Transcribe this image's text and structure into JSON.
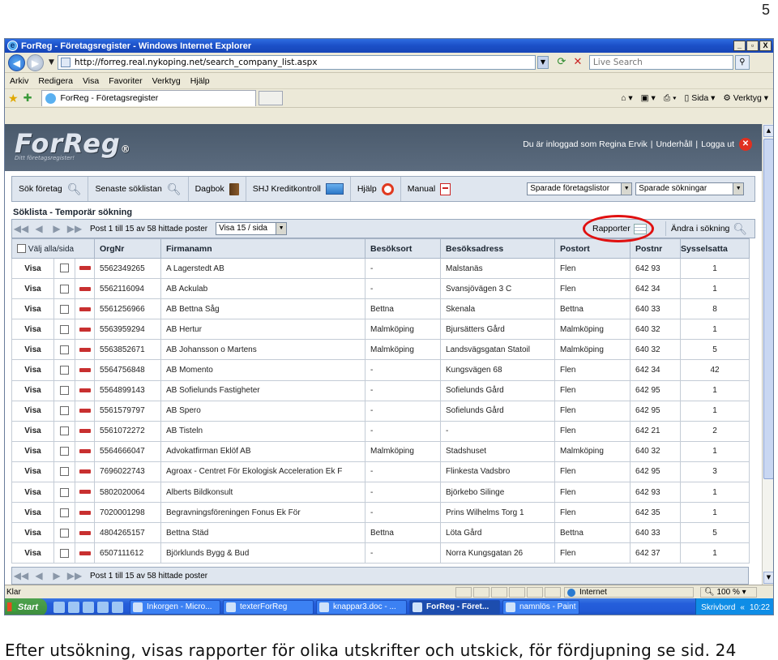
{
  "page_number": "5",
  "caption": "Efter utsökning, visas rapporter för olika utskrifter och utskick, för fördjupning se sid. 24",
  "window": {
    "title": "ForReg - Företagsregister - Windows Internet Explorer",
    "minimize": "_",
    "maximize": "▫",
    "close": "X"
  },
  "address_bar": {
    "url": "http://forreg.real.nykoping.net/search_company_list.aspx",
    "search_placeholder": "Live Search"
  },
  "menu": [
    "Arkiv",
    "Redigera",
    "Visa",
    "Favoriter",
    "Verktyg",
    "Hjälp"
  ],
  "tab": {
    "title": "ForReg - Företagsregister"
  },
  "command_bar": {
    "page": "Sida",
    "tools": "Verktyg"
  },
  "app": {
    "logo": "ForReg",
    "slogan": "Ditt företagsregister!",
    "user_text": "Du är inloggad som Regina Ervik",
    "maintenance": "Underhåll",
    "logout": "Logga ut",
    "toolbar": {
      "sok_foretag": "Sök företag",
      "senaste": "Senaste söklistan",
      "dagbok": "Dagbok",
      "shj": "SHJ Kreditkontroll",
      "hjalp": "Hjälp",
      "manual": "Manual",
      "sparade_listor": "Sparade företagslistor",
      "sparade_sokningar": "Sparade sökningar"
    },
    "list_title": "Söklista",
    "list_subtitle": "Temporär sökning",
    "pager_text": "Post 1 till 15 av 58 hittade poster",
    "per_page": "Visa 15 / sida",
    "rapporter": "Rapporter",
    "andra_sokning": "Ändra i sökning",
    "select_all": "Välj alla/sida",
    "columns": [
      "OrgNr",
      "Firmanamn",
      "Besöksort",
      "Besöksadress",
      "Postort",
      "Postnr",
      "Sysselsatta"
    ],
    "visa_label": "Visa",
    "rows": [
      [
        "5562349265",
        "A Lagerstedt AB",
        "-",
        "Malstanäs",
        "Flen",
        "642 93",
        "1"
      ],
      [
        "5562116094",
        "AB Ackulab",
        "-",
        "Svansjövägen 3 C",
        "Flen",
        "642 34",
        "1"
      ],
      [
        "5561256966",
        "AB Bettna Såg",
        "Bettna",
        "Skenala",
        "Bettna",
        "640 33",
        "8"
      ],
      [
        "5563959294",
        "AB Hertur",
        "Malmköping",
        "Bjursätters Gård",
        "Malmköping",
        "640 32",
        "1"
      ],
      [
        "5563852671",
        "AB Johansson o Martens",
        "Malmköping",
        "Landsvägsgatan Statoil",
        "Malmköping",
        "640 32",
        "5"
      ],
      [
        "5564756848",
        "AB Momento",
        "-",
        "Kungsvägen 68",
        "Flen",
        "642 34",
        "42"
      ],
      [
        "5564899143",
        "AB Sofielunds Fastigheter",
        "-",
        "Sofielunds Gård",
        "Flen",
        "642 95",
        "1"
      ],
      [
        "5561579797",
        "AB Spero",
        "-",
        "Sofielunds Gård",
        "Flen",
        "642 95",
        "1"
      ],
      [
        "5561072272",
        "AB Tisteln",
        "-",
        "-",
        "Flen",
        "642 21",
        "2"
      ],
      [
        "5564666047",
        "Advokatfirman Eklöf AB",
        "Malmköping",
        "Stadshuset",
        "Malmköping",
        "640 32",
        "1"
      ],
      [
        "7696022743",
        "Agroax - Centret För Ekologisk Acceleration Ek F",
        "-",
        "Flinkesta Vadsbro",
        "Flen",
        "642 95",
        "3"
      ],
      [
        "5802020064",
        "Alberts Bildkonsult",
        "-",
        "Björkebo Silinge",
        "Flen",
        "642 93",
        "1"
      ],
      [
        "7020001298",
        "Begravningsföreningen Fonus Ek För",
        "-",
        "Prins Wilhelms Torg 1",
        "Flen",
        "642 35",
        "1"
      ],
      [
        "4804265157",
        "Bettna Städ",
        "Bettna",
        "Löta Gård",
        "Bettna",
        "640 33",
        "5"
      ],
      [
        "6507111612",
        "Björklunds Bygg & Bud",
        "-",
        "Norra Kungsgatan 26",
        "Flen",
        "642 37",
        "1"
      ]
    ]
  },
  "statusbar": {
    "left": "Klar",
    "zone": "Internet",
    "zoom": "100 %"
  },
  "taskbar": {
    "start": "Start",
    "tasks": [
      "Inkorgen - Micro...",
      "texterForReg",
      "knappar3.doc - ...",
      "ForReg - Föret...",
      "namnlös - Paint"
    ],
    "skrivbord": "Skrivbord",
    "time": "10:22"
  }
}
